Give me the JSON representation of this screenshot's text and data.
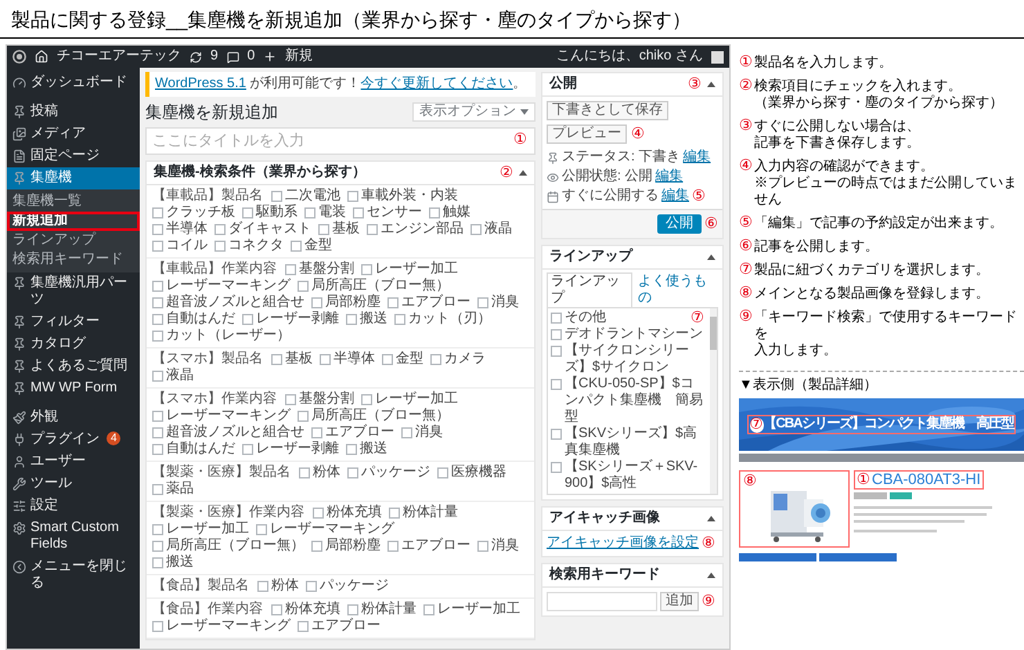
{
  "page_title": "製品に関する登録__集塵機を新規追加（業界から探す・塵のタイプから探す）",
  "admin_bar": {
    "site": "チコーエアーテック",
    "updates": "9",
    "comments": "0",
    "new": "新規",
    "greeting": "こんにちは、chiko さん"
  },
  "sidebar": [
    {
      "label": "ダッシュボード",
      "selected": false
    },
    {
      "label": "投稿",
      "selected": false
    },
    {
      "label": "メディア",
      "selected": false
    },
    {
      "label": "固定ページ",
      "selected": false
    },
    {
      "label": "集塵機",
      "selected": true,
      "children": [
        {
          "label": "集塵機一覧",
          "selected": false
        },
        {
          "label": "新規追加",
          "selected": true
        },
        {
          "label": "ラインアップ",
          "selected": false
        },
        {
          "label": "検索用キーワード",
          "selected": false
        }
      ]
    },
    {
      "label": "集塵機汎用パーツ",
      "selected": false
    },
    {
      "label": "フィルター",
      "selected": false
    },
    {
      "label": "カタログ",
      "selected": false
    },
    {
      "label": "よくあるご質問",
      "selected": false
    },
    {
      "label": "MW WP Form",
      "selected": false
    },
    {
      "label": "外観",
      "selected": false
    },
    {
      "label": "プラグイン",
      "selected": false,
      "badge": "4"
    },
    {
      "label": "ユーザー",
      "selected": false
    },
    {
      "label": "ツール",
      "selected": false
    },
    {
      "label": "設定",
      "selected": false
    },
    {
      "label": "Smart Custom Fields",
      "selected": false
    },
    {
      "label": "メニューを閉じる",
      "selected": false
    }
  ],
  "screen_options": "表示オプション",
  "notice": {
    "link": "WordPress 5.1",
    "text": " が利用可能です！",
    "action": "今すぐ更新してください",
    "end": "。"
  },
  "heading": "集塵機を新規追加",
  "title_field": {
    "placeholder": "ここにタイトルを入力",
    "marker": "①"
  },
  "search_box": {
    "title": "集塵機-検索条件（業界から探す）",
    "marker": "②",
    "rows": [
      {
        "label": "【車載品】製品名",
        "options": [
          {
            "label": "二次電池",
            "checked": false
          },
          {
            "label": "車載外装・内装",
            "checked": false
          },
          {
            "label": "クラッチ板",
            "checked": false
          },
          {
            "label": "駆動系",
            "checked": false
          },
          {
            "label": "電装",
            "checked": false
          },
          {
            "label": "センサー",
            "checked": false
          },
          {
            "label": "触媒",
            "checked": false
          },
          {
            "label": "半導体",
            "checked": false
          },
          {
            "label": "ダイキャスト",
            "checked": false
          },
          {
            "label": "基板",
            "checked": false
          },
          {
            "label": "エンジン部品",
            "checked": false
          },
          {
            "label": "液晶",
            "checked": false
          },
          {
            "label": "コイル",
            "checked": false
          },
          {
            "label": "コネクタ",
            "checked": false
          },
          {
            "label": "金型",
            "checked": false
          }
        ]
      },
      {
        "label": "【車載品】作業内容",
        "options": [
          {
            "label": "基盤分割",
            "checked": false
          },
          {
            "label": "レーザー加工",
            "checked": false
          },
          {
            "label": "レーザーマーキング",
            "checked": false
          },
          {
            "label": "局所高圧（ブロー無）",
            "checked": false
          },
          {
            "label": "超音波ノズルと組合せ",
            "checked": false
          },
          {
            "label": "局部粉塵",
            "checked": false
          },
          {
            "label": "エアブロー",
            "checked": false
          },
          {
            "label": "消臭",
            "checked": false
          },
          {
            "label": "自動はんだ",
            "checked": false
          },
          {
            "label": "レーザー剥離",
            "checked": false
          },
          {
            "label": "搬送",
            "checked": false
          },
          {
            "label": "カット（刃）",
            "checked": false
          },
          {
            "label": "カット（レーザー）",
            "checked": false
          }
        ]
      },
      {
        "label": "【スマホ】製品名",
        "options": [
          {
            "label": "基板",
            "checked": false
          },
          {
            "label": "半導体",
            "checked": false
          },
          {
            "label": "金型",
            "checked": false
          },
          {
            "label": "カメラ",
            "checked": false
          },
          {
            "label": "液晶",
            "checked": false
          }
        ]
      },
      {
        "label": "【スマホ】作業内容",
        "options": [
          {
            "label": "基盤分割",
            "checked": false
          },
          {
            "label": "レーザー加工",
            "checked": false
          },
          {
            "label": "レーザーマーキング",
            "checked": false
          },
          {
            "label": "局所高圧（ブロー無）",
            "checked": false
          },
          {
            "label": "超音波ノズルと組合せ",
            "checked": false
          },
          {
            "label": "エアブロー",
            "checked": false
          },
          {
            "label": "消臭",
            "checked": false
          },
          {
            "label": "自動はんだ",
            "checked": false
          },
          {
            "label": "レーザー剥離",
            "checked": false
          },
          {
            "label": "搬送",
            "checked": false
          }
        ]
      },
      {
        "label": "【製薬・医療】製品名",
        "options": [
          {
            "label": "粉体",
            "checked": false
          },
          {
            "label": "パッケージ",
            "checked": false
          },
          {
            "label": "医療機器",
            "checked": false
          },
          {
            "label": "薬品",
            "checked": false
          }
        ]
      },
      {
        "label": "【製薬・医療】作業内容",
        "options": [
          {
            "label": "粉体充填",
            "checked": false
          },
          {
            "label": "粉体計量",
            "checked": false
          },
          {
            "label": "レーザー加工",
            "checked": false
          },
          {
            "label": "レーザーマーキング",
            "checked": false
          },
          {
            "label": "局所高圧（ブロー無）",
            "checked": false
          },
          {
            "label": "局部粉塵",
            "checked": false
          },
          {
            "label": "エアブロー",
            "checked": false
          },
          {
            "label": "消臭",
            "checked": false
          },
          {
            "label": "搬送",
            "checked": false
          }
        ]
      },
      {
        "label": "【食品】製品名",
        "options": [
          {
            "label": "粉体",
            "checked": false
          },
          {
            "label": "パッケージ",
            "checked": false
          }
        ]
      },
      {
        "label": "【食品】作業内容",
        "options": [
          {
            "label": "粉体充填",
            "checked": false
          },
          {
            "label": "粉体計量",
            "checked": false
          },
          {
            "label": "レーザー加工",
            "checked": false
          },
          {
            "label": "レーザーマーキング",
            "checked": false
          },
          {
            "label": "エアブロー",
            "checked": false
          }
        ]
      }
    ]
  },
  "publish": {
    "title": "公開",
    "marker": "③",
    "save": "下書きとして保存",
    "preview": "プレビュー",
    "preview_marker": "④",
    "status": [
      {
        "label": "ステータス: 下書き",
        "link": "編集"
      },
      {
        "label": "公開状態: 公開",
        "link": "編集"
      },
      {
        "label": "すぐに公開する",
        "link": "編集",
        "marker": "⑤"
      }
    ],
    "button": "公開",
    "button_marker": "⑥"
  },
  "lineup": {
    "title": "ラインアップ",
    "marker": "⑦",
    "tabs": [
      {
        "label": "ラインアップ",
        "selected": true
      },
      {
        "label": "よく使うもの",
        "selected": false
      }
    ],
    "items": [
      {
        "label": "その他",
        "checked": false
      },
      {
        "label": "デオドラントマシーン",
        "checked": false
      },
      {
        "label": "【サイクロンシリーズ】$サイクロン",
        "checked": false
      },
      {
        "label": "【CKU-050-SP】$コンパクト集塵機　簡易型",
        "checked": false
      },
      {
        "label": "【SKVシリーズ】$高真集塵機",
        "checked": false
      },
      {
        "label": "【SKシリーズ＋SKV-900】$高性",
        "checked": false
      }
    ]
  },
  "eyecatch": {
    "title": "アイキャッチ画像",
    "link": "アイキャッチ画像を設定",
    "marker": "⑧"
  },
  "keyword": {
    "title": "検索用キーワード",
    "button": "追加",
    "marker": "⑨"
  },
  "notes": [
    {
      "marker": "①",
      "lines": [
        "製品名を入力します。"
      ]
    },
    {
      "marker": "②",
      "lines": [
        "検索項目にチェックを入れます。",
        "（業界から探す・塵のタイプから探す）"
      ]
    },
    {
      "marker": "③",
      "lines": [
        "すぐに公開しない場合は、",
        "記事を下書き保存します。"
      ]
    },
    {
      "marker": "④",
      "lines": [
        "入力内容の確認ができます。",
        "※プレビューの時点ではまだ公開していません"
      ]
    },
    {
      "marker": "⑤",
      "lines": [
        "「編集」で記事の予約設定が出来ます。"
      ]
    },
    {
      "marker": "⑥",
      "lines": [
        "記事を公開します。"
      ]
    },
    {
      "marker": "⑦",
      "lines": [
        "製品に紐づくカテゴリを選択します。"
      ]
    },
    {
      "marker": "⑧",
      "lines": [
        "メインとなる製品画像を登録します。"
      ]
    },
    {
      "marker": "⑨",
      "lines": [
        "「キーワード検索」で使用するキーワードを",
        "入力します。"
      ]
    }
  ],
  "display": {
    "heading": "▼表示側（製品詳細）",
    "banner_marker": "⑦",
    "banner_title": "【CBAシリーズ】コンパクト集塵機　高圧型",
    "image_marker": "⑧",
    "product_marker": "①",
    "product_name": "CBA-080AT3-HI"
  }
}
